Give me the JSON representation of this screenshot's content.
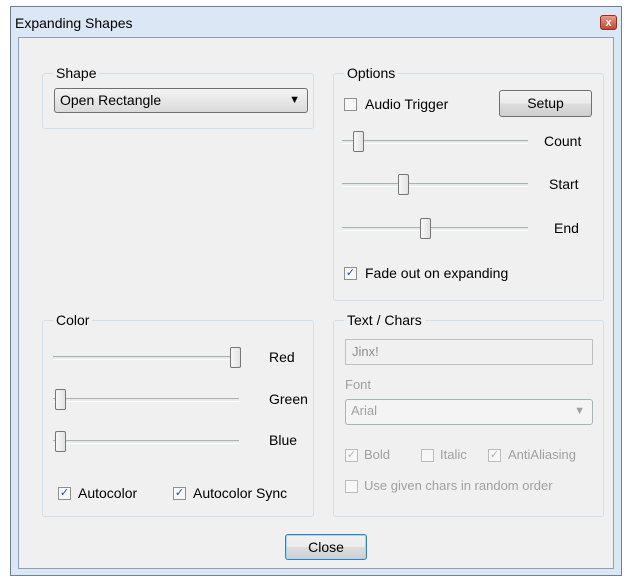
{
  "window": {
    "title": "Expanding Shapes",
    "close_glyph": "x"
  },
  "shape": {
    "group_label": "Shape",
    "combo_value": "Open Rectangle",
    "combo_arrow": "▼"
  },
  "options": {
    "group_label": "Options",
    "audio_trigger": {
      "label": "Audio Trigger",
      "checked": false
    },
    "setup_label": "Setup",
    "sliders": [
      {
        "label": "Count",
        "value_fraction": 0.05
      },
      {
        "label": "Start",
        "value_fraction": 0.31
      },
      {
        "label": "End",
        "value_fraction": 0.44
      }
    ],
    "fade_out": {
      "label": "Fade out on expanding",
      "checked": true
    }
  },
  "color": {
    "group_label": "Color",
    "sliders": [
      {
        "label": "Red",
        "value_fraction": 1.0
      },
      {
        "label": "Green",
        "value_fraction": 0.0
      },
      {
        "label": "Blue",
        "value_fraction": 0.0
      }
    ],
    "autocolor": {
      "label": "Autocolor",
      "checked": true
    },
    "autocolor_sync": {
      "label": "Autocolor Sync",
      "checked": true
    }
  },
  "text_chars": {
    "group_label": "Text / Chars",
    "text_value": "Jinx!",
    "font_label": "Font",
    "font_value": "Arial",
    "font_arrow": "▼",
    "bold": {
      "label": "Bold",
      "checked": true
    },
    "italic": {
      "label": "Italic",
      "checked": false
    },
    "antialiasing": {
      "label": "AntiAliasing",
      "checked": true
    },
    "random_order": {
      "label": "Use given chars in random order",
      "checked": false
    }
  },
  "close_button": {
    "label": "Close"
  },
  "check_glyph": "✓"
}
